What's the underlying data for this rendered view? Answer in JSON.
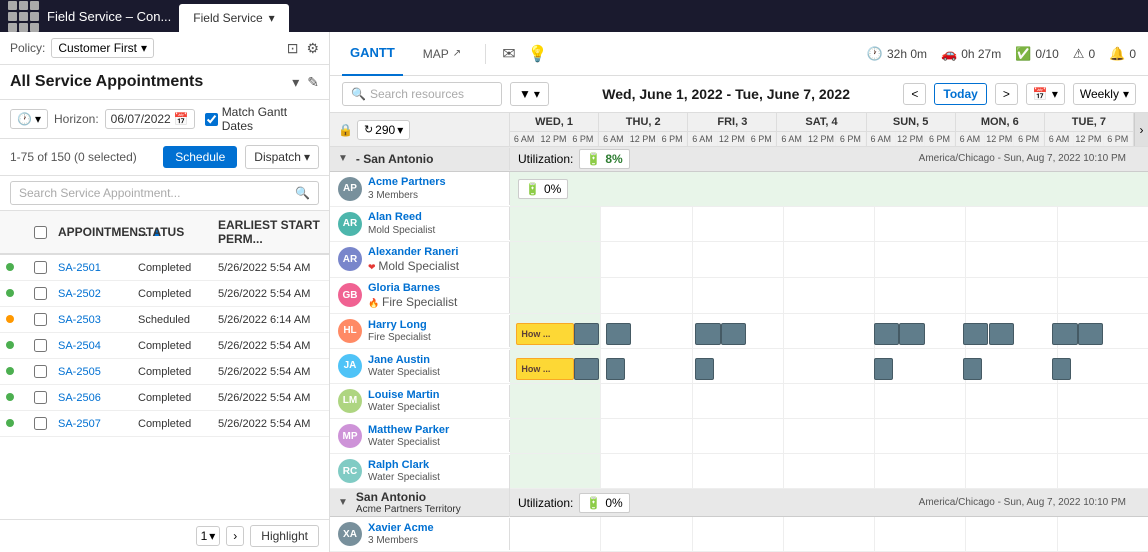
{
  "topbar": {
    "title": "Field Service – Con...",
    "tab_label": "Field Service",
    "tab_chevron": "▾"
  },
  "left": {
    "policy_label": "Policy:",
    "policy_value": "Customer First",
    "asa_title": "All Service Appointments",
    "horizon_label": "Horizon:",
    "horizon_date": "06/07/2022",
    "match_gantt_label": "Match Gantt Dates",
    "count_text": "1-75 of 150 (0 selected)",
    "schedule_btn": "Schedule",
    "dispatch_btn": "Dispatch",
    "search_placeholder": "Search Service Appointment...",
    "columns": [
      "",
      "",
      "APPOINTMEN...",
      "STATUS",
      "EARLIEST START PERM..."
    ],
    "rows": [
      {
        "id": "SA-2501",
        "status": "Completed",
        "date": "5/26/2022 5:54 AM",
        "dot": "green"
      },
      {
        "id": "SA-2502",
        "status": "Completed",
        "date": "5/26/2022 5:54 AM",
        "dot": "green"
      },
      {
        "id": "SA-2503",
        "status": "Scheduled",
        "date": "5/26/2022 6:14 AM",
        "dot": "yellow"
      },
      {
        "id": "SA-2504",
        "status": "Completed",
        "date": "5/26/2022 5:54 AM",
        "dot": "green"
      },
      {
        "id": "SA-2505",
        "status": "Completed",
        "date": "5/26/2022 5:54 AM",
        "dot": "green"
      },
      {
        "id": "SA-2506",
        "status": "Completed",
        "date": "5/26/2022 5:54 AM",
        "dot": "green"
      },
      {
        "id": "SA-2507",
        "status": "Completed",
        "date": "5/26/2022 5:54 AM",
        "dot": "green"
      }
    ],
    "pagination": {
      "page": "1",
      "next_label": "›",
      "highlight_label": "Highlight"
    }
  },
  "right": {
    "tabs": [
      {
        "label": "GANTT",
        "active": true
      },
      {
        "label": "MAP",
        "active": false
      }
    ],
    "stats": {
      "time": "32h 0m",
      "drive": "0h 27m",
      "tasks": "0/10",
      "alerts": "0",
      "notif": "0"
    },
    "date_range": "Wed, June 1, 2022 - Tue, June 7, 2022",
    "today_btn": "Today",
    "view": "Weekly",
    "search_resources_placeholder": "Search resources",
    "gantt_count": "290",
    "days": [
      {
        "label": "WED, 1",
        "slots": [
          "6 AM",
          "12 PM",
          "6 PM"
        ]
      },
      {
        "label": "THU, 2",
        "slots": [
          "6 AM",
          "12 PM",
          "6 PM"
        ]
      },
      {
        "label": "FRI, 3",
        "slots": [
          "6 AM",
          "12 PM",
          "6 PM"
        ]
      },
      {
        "label": "SAT, 4",
        "slots": [
          "6 AM",
          "12 PM",
          "6 PM"
        ]
      },
      {
        "label": "SUN, 5",
        "slots": [
          "6 AM",
          "12 PM",
          "6 PM"
        ]
      },
      {
        "label": "MON, 6",
        "slots": [
          "6 AM",
          "12 PM",
          "6 PM"
        ]
      },
      {
        "label": "TUE, 7",
        "slots": [
          "6 AM",
          "12 PM",
          "6 PM"
        ]
      }
    ],
    "territory": {
      "name": "- San Antonio",
      "utilization_label": "Utilization:",
      "utilization_value": "8%",
      "timezone": "America/Chicago - Sun, Aug 7, 2022 10:10 PM"
    },
    "territory2": {
      "name": "San Antonio",
      "subtitle": "Acme Partners Territory",
      "utilization_label": "Utilization:",
      "utilization_value": "0%",
      "timezone": "America/Chicago - Sun, Aug 7, 2022 10:10 PM"
    },
    "resources": [
      {
        "name": "Acme Partners",
        "sub": "3 Members",
        "type": "group",
        "util": "0%",
        "initials": "AP",
        "color": "#78909c"
      },
      {
        "name": "Alan Reed",
        "sub": "Mold Specialist",
        "type": "person",
        "initials": "AR",
        "color": "#4db6ac"
      },
      {
        "name": "Alexander Raneri",
        "sub": "Mold Specialist",
        "type": "person",
        "initials": "AR2",
        "color": "#7986cb",
        "heart": true
      },
      {
        "name": "Gloria Barnes",
        "sub": "Fire Specialist",
        "type": "person",
        "initials": "GB",
        "color": "#f06292",
        "fire": true
      },
      {
        "name": "Harry Long",
        "sub": "Fire Specialist",
        "type": "person",
        "initials": "HL",
        "color": "#ff8a65",
        "tasks": [
          {
            "label": "How...",
            "col": 0,
            "type": "yellow"
          },
          {
            "label": "",
            "col": 0,
            "type": "gray"
          }
        ]
      },
      {
        "name": "Jane Austin",
        "sub": "Water Specialist",
        "type": "person",
        "initials": "JA",
        "color": "#4fc3f7",
        "tasks": [
          {
            "label": "How...",
            "col": 0,
            "type": "yellow"
          },
          {
            "label": "",
            "col": 0,
            "type": "gray"
          }
        ]
      },
      {
        "name": "Louise Martin",
        "sub": "Water Specialist",
        "type": "person",
        "initials": "LM",
        "color": "#aed581"
      },
      {
        "name": "Matthew Parker",
        "sub": "Water Specialist",
        "type": "person",
        "initials": "MP",
        "color": "#ce93d8"
      },
      {
        "name": "Ralph Clark",
        "sub": "Water Specialist",
        "type": "person",
        "initials": "RC",
        "color": "#80cbc4"
      },
      {
        "name": "Xavier Acme",
        "sub": "3 Members",
        "type": "group",
        "initials": "XA",
        "color": "#78909c"
      }
    ]
  }
}
